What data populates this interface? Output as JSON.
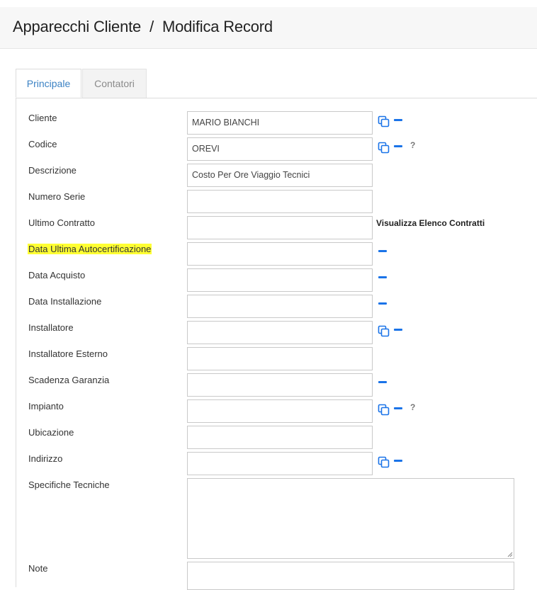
{
  "header": {
    "section": "Apparecchi Cliente",
    "separator": "/",
    "page": "Modifica Record"
  },
  "tabs": [
    {
      "label": "Principale",
      "active": true
    },
    {
      "label": "Contatori",
      "active": false
    }
  ],
  "colors": {
    "accent": "#1a73e8",
    "highlight": "#ffff33",
    "tab_active_text": "#3b82c4"
  },
  "form": {
    "cliente": {
      "label": "Cliente",
      "value": "MARIO BIANCHI"
    },
    "codice": {
      "label": "Codice",
      "value": "OREVI",
      "help": "?"
    },
    "descrizione": {
      "label": "Descrizione",
      "value": "Costo Per Ore Viaggio Tecnici"
    },
    "numero_serie": {
      "label": "Numero Serie",
      "value": ""
    },
    "ultimo_contratto": {
      "label": "Ultimo Contratto",
      "value": "",
      "link": "Visualizza Elenco Contratti"
    },
    "data_ultima_autocert": {
      "label": "Data Ultima Autocertificazione",
      "value": ""
    },
    "data_acquisto": {
      "label": "Data Acquisto",
      "value": ""
    },
    "data_installazione": {
      "label": "Data Installazione",
      "value": ""
    },
    "installatore": {
      "label": "Installatore",
      "value": ""
    },
    "installatore_esterno": {
      "label": "Installatore Esterno",
      "value": ""
    },
    "scadenza_garanzia": {
      "label": "Scadenza Garanzia",
      "value": ""
    },
    "impianto": {
      "label": "Impianto",
      "value": "",
      "help": "?"
    },
    "ubicazione": {
      "label": "Ubicazione",
      "value": ""
    },
    "indirizzo": {
      "label": "Indirizzo",
      "value": ""
    },
    "specifiche_tecniche": {
      "label": "Specifiche Tecniche",
      "value": ""
    },
    "note": {
      "label": "Note",
      "value": ""
    }
  }
}
